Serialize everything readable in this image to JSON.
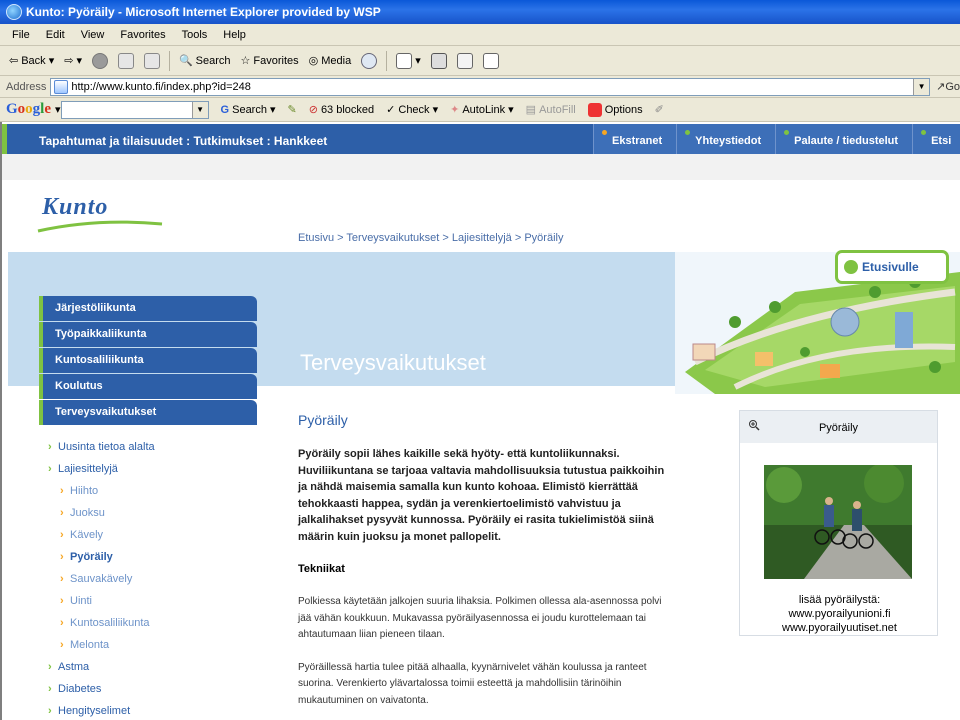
{
  "window": {
    "title": "Kunto: Pyöräily - Microsoft Internet Explorer provided by WSP"
  },
  "menu": [
    "File",
    "Edit",
    "View",
    "Favorites",
    "Tools",
    "Help"
  ],
  "toolbar": {
    "back": "Back",
    "search": "Search",
    "favorites": "Favorites",
    "media": "Media"
  },
  "address": {
    "label": "Address",
    "url": "http://www.kunto.fi/index.php?id=248",
    "go": "Go"
  },
  "googlebar": {
    "search": "Search",
    "blocked": "63 blocked",
    "check": "Check",
    "autolink": "AutoLink",
    "autofill": "AutoFill",
    "options": "Options"
  },
  "site": {
    "topnav": {
      "crumbs": "Tapahtumat ja tilaisuudet  :  Tutkimukset  :  Hankkeet",
      "tabs": [
        "Ekstranet",
        "Yhteystiedot",
        "Palaute / tiedustelut",
        "Etsi"
      ]
    },
    "logo": "Kunto",
    "breadcrumb": "Etusivu > Terveysvaikutukset > Lajiesittelyjä > Pyöräily",
    "hero_title": "Terveysvaikutukset",
    "etusivulle": "Etusivulle",
    "nav": [
      "Järjestöliikunta",
      "Työpaikkaliikunta",
      "Kuntosaliliikunta",
      "Koulutus",
      "Terveysvaikutukset"
    ],
    "subnav": [
      {
        "label": "Uusinta tietoa alalta",
        "level": 1
      },
      {
        "label": "Lajiesittelyjä",
        "level": 1
      },
      {
        "label": "Hiihto",
        "level": 2
      },
      {
        "label": "Juoksu",
        "level": 2
      },
      {
        "label": "Kävely",
        "level": 2
      },
      {
        "label": "Pyöräily",
        "level": 2
      },
      {
        "label": "Sauvakävely",
        "level": 2
      },
      {
        "label": "Uinti",
        "level": 2
      },
      {
        "label": "Kuntosaliliikunta",
        "level": 2
      },
      {
        "label": "Melonta",
        "level": 2
      },
      {
        "label": "Astma",
        "level": 1
      },
      {
        "label": "Diabetes",
        "level": 1
      },
      {
        "label": "Hengityselimet",
        "level": 1
      }
    ],
    "content": {
      "title": "Pyöräily",
      "lead": "Pyöräily sopii lähes kaikille sekä hyöty- että kuntoliikunnaksi. Huviliikuntana se tarjoaa valtavia mahdollisuuksia tutustua paikkoihin ja nähdä maisemia samalla kun kunto kohoaa. Elimistö kierrättää tehokkaasti happea, sydän ja verenkiertoelimistö vahvistuu ja jalkalihakset pysyvät kunnossa. Pyöräily ei rasita tukielimistöä siinä määrin kuin juoksu ja monet pallopelit.",
      "subtitle": "Tekniikat",
      "para1": "Polkiessa käytetään jalkojen suuria lihaksia. Polkimen ollessa ala-asennossa polvi jää vähän koukkuun. Mukavassa pyöräilyasennossa ei joudu kurottelemaan tai ahtautumaan liian pieneen tilaan.",
      "para2": "Pyöräillessä hartia tulee pitää alhaalla, kyynärnivelet vähän koulussa ja ranteet suorina. Verenkierto ylävartalossa toimii esteettä ja mahdollisiin tärinöihin mukautuminen on vaivatonta."
    },
    "sidebox": {
      "title": "Pyöräily",
      "caption1": "lisää pyöräilystä:",
      "link1": "www.pyorailyunioni.fi",
      "link2": "www.pyorailyuutiset.net"
    }
  }
}
